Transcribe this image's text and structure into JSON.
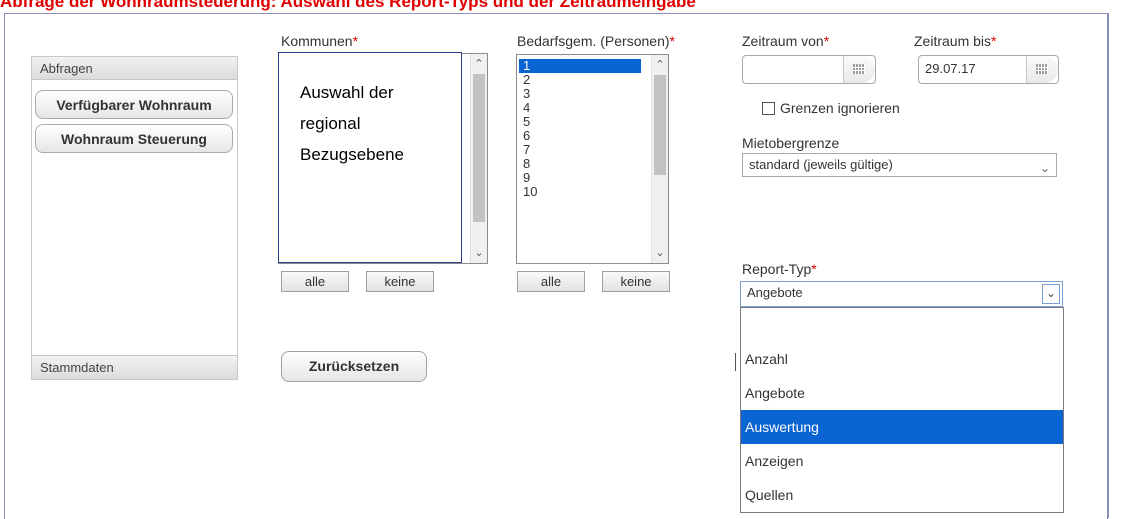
{
  "banner": {
    "text": "Abfrage der Wohnraumsteuerung: Auswahl des Report-Typs und der Zeitraumeingabe"
  },
  "nav": {
    "header": "Abfragen",
    "items": [
      {
        "label": "Verfügbarer Wohnraum"
      },
      {
        "label": "Wohnraum Steuerung"
      }
    ],
    "footer": "Stammdaten"
  },
  "kommunen": {
    "label": "Kommunen",
    "required": "*",
    "callout": [
      "Auswahl der",
      "regional",
      "Bezugsebene"
    ],
    "all_label": "alle",
    "none_label": "keine"
  },
  "bedarf": {
    "label": "Bedarfsgem. (Personen)",
    "required": "*",
    "items": [
      "1",
      "2",
      "3",
      "4",
      "5",
      "6",
      "7",
      "8",
      "9",
      "10"
    ],
    "selected": "1",
    "all_label": "alle",
    "none_label": "keine"
  },
  "zeitraum_von": {
    "label": "Zeitraum von",
    "required": "*",
    "value": ""
  },
  "zeitraum_bis": {
    "label": "Zeitraum bis",
    "required": "*",
    "value": "29.07.17"
  },
  "grenzen": {
    "label": "Grenzen ignorieren",
    "checked": false
  },
  "mietobergrenze": {
    "label": "Mietobergrenze",
    "value": "standard (jeweils gültige)"
  },
  "report_typ": {
    "label": "Report-Typ",
    "required": "*",
    "value": "Angebote",
    "options": [
      "",
      "Anzahl",
      "Angebote",
      "Auswertung",
      "Anzeigen",
      "Quellen"
    ],
    "highlighted": "Auswertung"
  },
  "reset": {
    "label": "Zurücksetzen"
  },
  "colors": {
    "accent": "#0a64d2",
    "required": "#e00000",
    "frame": "#8a8fbf"
  }
}
